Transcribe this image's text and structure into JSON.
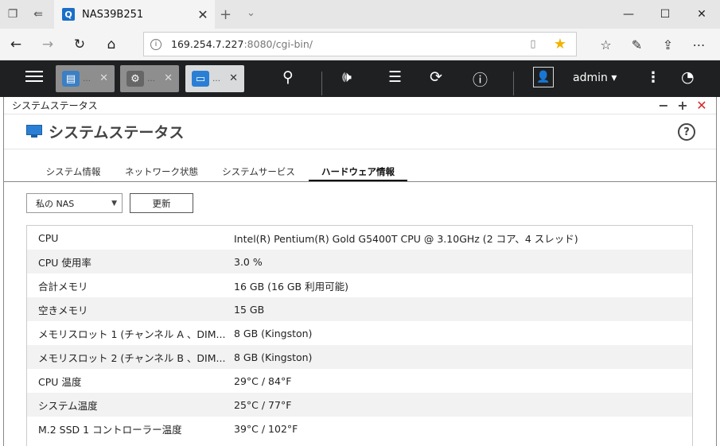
{
  "browser": {
    "tab_title": "NAS39B251",
    "tab_logo": "Q",
    "url_host": "169.254.7.227",
    "url_rest": ":8080/cgi-bin/",
    "icons": [
      "tab-set-icon",
      "back-icon",
      "forward-icon",
      "refresh-icon",
      "home-icon",
      "reading-view-icon",
      "favorite-star-icon",
      "favorites-icon",
      "notes-icon",
      "share-icon",
      "more-icon"
    ]
  },
  "qts": {
    "user": "admin",
    "user_caret": "▾",
    "app_tabs": [
      {
        "name": "storage",
        "dots": "…"
      },
      {
        "name": "control-panel",
        "dots": "…"
      },
      {
        "name": "system-status",
        "dots": "…"
      }
    ]
  },
  "window": {
    "title": "システムステータス",
    "heading": "システムステータス",
    "tabs": [
      "システム情報",
      "ネットワーク状態",
      "システムサービス",
      "ハードウェア情報"
    ],
    "selected_tab": "ハードウェア情報"
  },
  "controls": {
    "nas_select": "私の NAS",
    "refresh_label": "更新"
  },
  "hardware": [
    {
      "label": "CPU",
      "value": "Intel(R) Pentium(R) Gold G5400T CPU @ 3.10GHz (2 コア、4 スレッド)"
    },
    {
      "label": "CPU 使用率",
      "value": "3.0 %"
    },
    {
      "label": "合計メモリ",
      "value": "16 GB (16 GB 利用可能)"
    },
    {
      "label": "空きメモリ",
      "value": "15 GB"
    },
    {
      "label": "メモリスロット 1 (チャンネル A 、DIM...",
      "value": "8 GB (Kingston)"
    },
    {
      "label": "メモリスロット 2 (チャンネル B 、DIM...",
      "value": "8 GB (Kingston)"
    },
    {
      "label": "CPU 温度",
      "value": "29°C / 84°F"
    },
    {
      "label": "システム温度",
      "value": "25°C / 77°F"
    },
    {
      "label": "M.2 SSD 1 コントローラー温度",
      "value": "39°C / 102°F"
    }
  ],
  "colors": {
    "accent": "#1a6fc9",
    "star": "#f0b400",
    "close_red": "#d42a2a",
    "qts_bar": "#1f2022"
  }
}
